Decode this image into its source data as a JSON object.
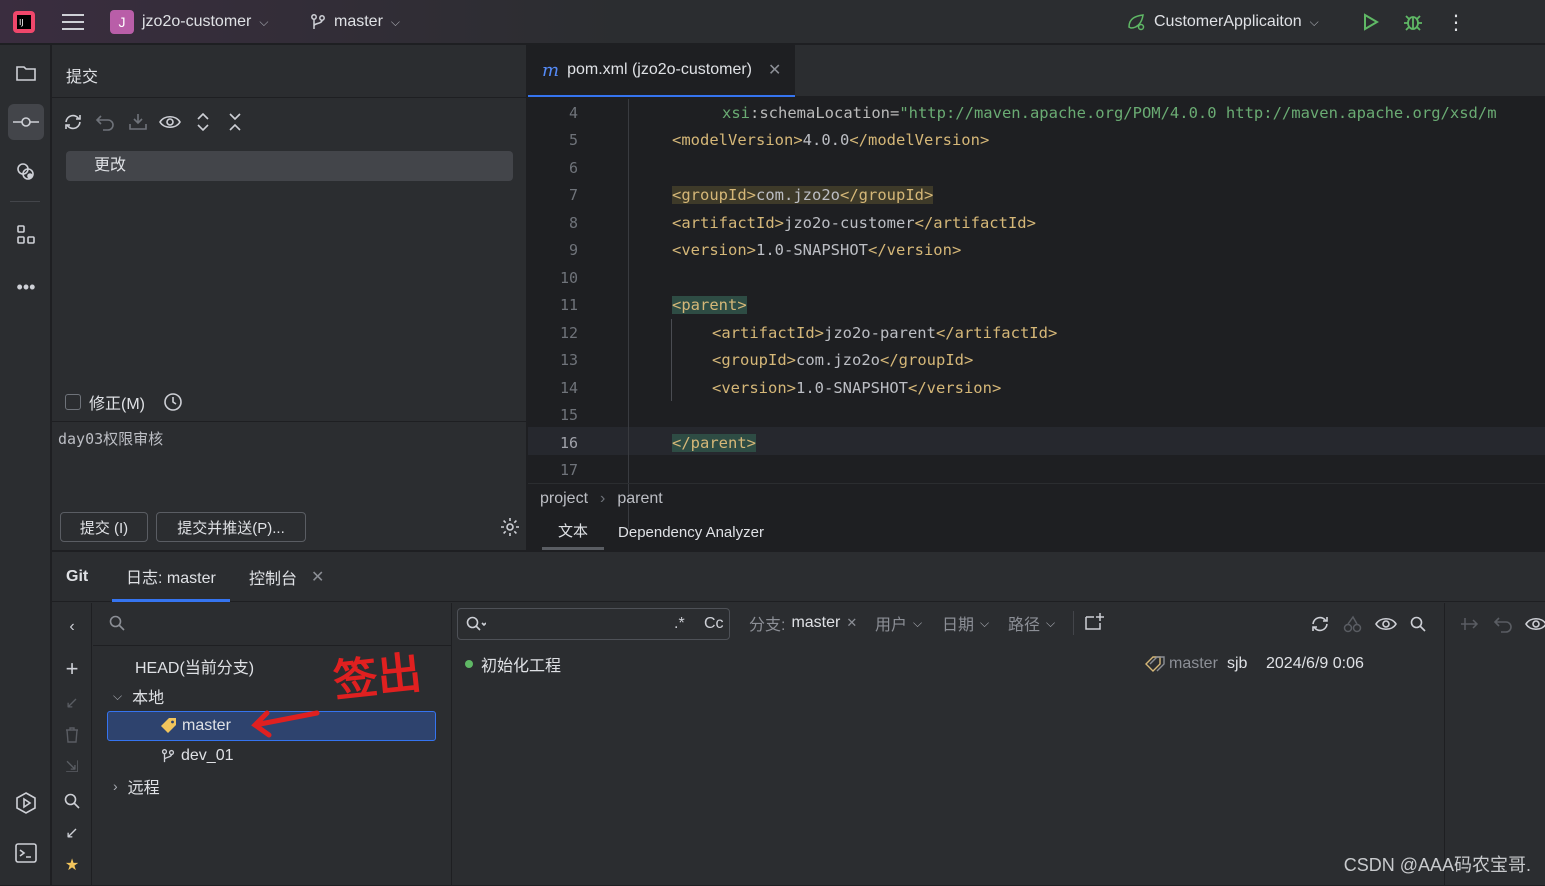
{
  "topbar": {
    "project_badge": "J",
    "project_name": "jzo2o-customer",
    "branch": "master",
    "run_config": "CustomerApplicaiton"
  },
  "commit_panel": {
    "title": "提交",
    "changes_node": "更改",
    "amend_label": "修正(M)",
    "message": "day03权限审核",
    "commit_button": "提交 (I)",
    "commit_push_button": "提交并推送(P)..."
  },
  "editor": {
    "tab_title": "pom.xml (jzo2o-customer)",
    "lines": [
      {
        "n": "4"
      },
      {
        "n": "5"
      },
      {
        "n": "6"
      },
      {
        "n": "7"
      },
      {
        "n": "8"
      },
      {
        "n": "9"
      },
      {
        "n": "10"
      },
      {
        "n": "11"
      },
      {
        "n": "12"
      },
      {
        "n": "13"
      },
      {
        "n": "14"
      },
      {
        "n": "15"
      },
      {
        "n": "16"
      },
      {
        "n": "17"
      }
    ],
    "code": {
      "l4_prefix": "xsi",
      "l4_attr": ":schemaLocation=",
      "l4_value": "\"http://maven.apache.org/POM/4.0.0 http://maven.apache.org/xsd/m",
      "l5_open": "<modelVersion>",
      "l5_text": "4.0.0",
      "l5_close": "</modelVersion>",
      "l7_open": "<groupId>",
      "l7_text": "com.jzo2o",
      "l7_close": "</groupId>",
      "l8_open": "<artifactId>",
      "l8_text": "jzo2o-customer",
      "l8_close": "</artifactId>",
      "l9_open": "<version>",
      "l9_text": "1.0-SNAPSHOT",
      "l9_close": "</version>",
      "l11": "<parent>",
      "l12_open": "<artifactId>",
      "l12_text": "jzo2o-parent",
      "l12_close": "</artifactId>",
      "l13_open": "<groupId>",
      "l13_text": "com.jzo2o",
      "l13_close": "</groupId>",
      "l14_open": "<version>",
      "l14_text": "1.0-SNAPSHOT",
      "l14_close": "</version>",
      "l16": "</parent>"
    },
    "breadcrumb": [
      "project",
      "parent"
    ],
    "bottom_tabs": [
      "文本",
      "Dependency Analyzer"
    ]
  },
  "git_window": {
    "tabs": [
      "Git",
      "日志: master",
      "控制台"
    ],
    "branches": {
      "head": "HEAD(当前分支)",
      "local": "本地",
      "local_items": [
        "master",
        "dev_01"
      ],
      "remote": "远程"
    },
    "annotation": "签出",
    "log_filters": {
      "regex": ".*",
      "case": "Cc",
      "branch_label": "分支:",
      "branch_value": "master",
      "user": "用户",
      "date": "日期",
      "path": "路径"
    },
    "commits": [
      {
        "message": "初始化工程",
        "ref": "master",
        "author": "sjb",
        "date": "2024/6/9 0:06"
      }
    ]
  },
  "watermark": "CSDN @AAA码农宝哥.",
  "colors": {
    "accent": "#3574f0",
    "selection": "#2e436e",
    "tag": "#d5b778",
    "string": "#6aab73",
    "run_green": "#5fb865",
    "annotation_red": "#e02020"
  }
}
